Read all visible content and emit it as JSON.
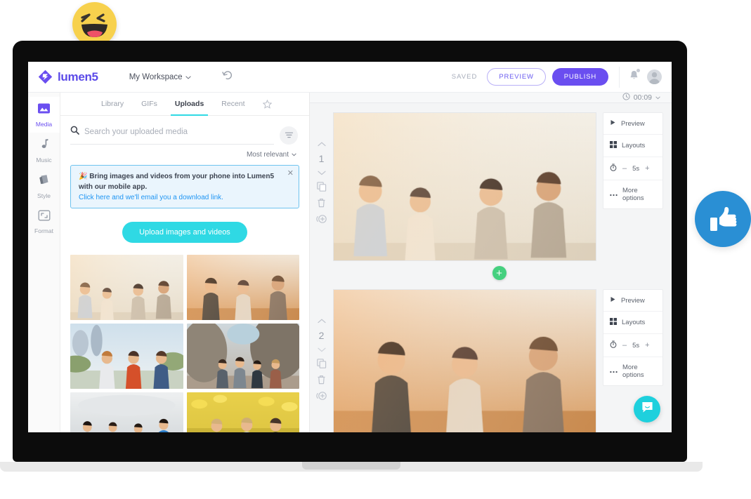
{
  "brand": {
    "name": "lumen5",
    "logo_icon": "lumen5-diamond-logo",
    "accent_purple": "#6a4ef0",
    "accent_cyan": "#2fd9e4",
    "accent_green": "#45d07f",
    "accent_blue": "#2a8fd4"
  },
  "header": {
    "workspace": "My Workspace",
    "workspace_chevron": "chevron-down-icon",
    "undo_icon": "undo-icon",
    "saved_label": "SAVED",
    "preview_label": "PREVIEW",
    "publish_label": "PUBLISH",
    "bell_icon": "bell-icon",
    "avatar_icon": "user-avatar-icon"
  },
  "rail": {
    "items": [
      {
        "label": "Media",
        "icon": "image-icon",
        "active": true
      },
      {
        "label": "Music",
        "icon": "music-note-icon",
        "active": false
      },
      {
        "label": "Style",
        "icon": "style-palette-icon",
        "active": false
      },
      {
        "label": "Format",
        "icon": "format-aspect-icon",
        "active": false
      }
    ]
  },
  "media_panel": {
    "tabs": [
      {
        "label": "Library",
        "active": false
      },
      {
        "label": "GIFs",
        "active": false
      },
      {
        "label": "Uploads",
        "active": true
      },
      {
        "label": "Recent",
        "active": false
      }
    ],
    "star_icon": "star-icon",
    "search": {
      "placeholder": "Search your uploaded media",
      "value": "",
      "icon": "search-icon"
    },
    "filter_icon": "filter-icon",
    "sort": {
      "label": "Most relevant",
      "chevron": "chevron-down-icon"
    },
    "promo": {
      "emoji": "party-popper-icon",
      "text": "Bring images and videos from your phone into Lumen5 with our mobile app.",
      "link": "Click here and we'll email you a download link.",
      "close_icon": "close-icon"
    },
    "upload_button": "Upload images and videos",
    "thumbnails": [
      {
        "name": "friends-laughing-sunset"
      },
      {
        "name": "women-hats-smiling"
      },
      {
        "name": "girls-city-skyline"
      },
      {
        "name": "hikers-rocky-canyon"
      },
      {
        "name": "kids-jumping-hallway"
      },
      {
        "name": "women-sunflower-field"
      }
    ]
  },
  "canvas": {
    "duration": "00:09",
    "duration_icon": "clock-icon",
    "duration_chevron": "chevron-down-icon",
    "add_scene_icon": "plus-circle-icon",
    "scene_controls": {
      "up_icon": "chevron-up-icon",
      "down_icon": "chevron-down-icon",
      "duplicate_icon": "copy-icon",
      "delete_icon": "trash-icon",
      "add_icon": "add-circle-icon"
    },
    "scene_options": {
      "preview": "Preview",
      "preview_icon": "play-icon",
      "layouts": "Layouts",
      "layouts_icon": "grid-layout-icon",
      "timer_icon": "stopwatch-icon",
      "minus": "–",
      "plus": "+",
      "more_options": "More options",
      "more_icon": "ellipsis-icon"
    },
    "scenes": [
      {
        "number": "1",
        "duration": "5s",
        "image": "friends-laughing-sunset"
      },
      {
        "number": "2",
        "duration": "5s",
        "image": "women-hats-smiling"
      }
    ]
  },
  "chat": {
    "icon": "chat-bubble-icon"
  },
  "decorations": {
    "emoji": {
      "name": "haha-emoji",
      "color": "#f7d14d"
    },
    "thumbs_up": {
      "name": "thumbs-up-icon",
      "color": "#2a8fd4"
    }
  }
}
